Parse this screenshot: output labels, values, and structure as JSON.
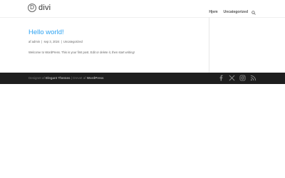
{
  "header": {
    "logo_glyph": "D",
    "logo_text": "divi",
    "nav": [
      {
        "label": "Hjem"
      },
      {
        "label": "Uncategorized"
      }
    ]
  },
  "post": {
    "title": "Hello world!",
    "meta": {
      "by": "af",
      "author": "admin",
      "sep": "|",
      "date": "sep 3, 2024",
      "category": "Uncategorized"
    },
    "excerpt": "Welcome to WordPress. This is your first post. Edit or delete it, then start writing!"
  },
  "footer": {
    "designed_by_prefix": "Designet af",
    "designer": "Elegant Themes",
    "separator": "|",
    "powered_prefix": "Drevet af",
    "platform": "WordPress",
    "social_icons": [
      "facebook-icon",
      "x-icon",
      "instagram-icon",
      "rss-icon"
    ]
  },
  "colors": {
    "accent": "#2ea3f2",
    "footer_bg": "#1e1e1e"
  }
}
